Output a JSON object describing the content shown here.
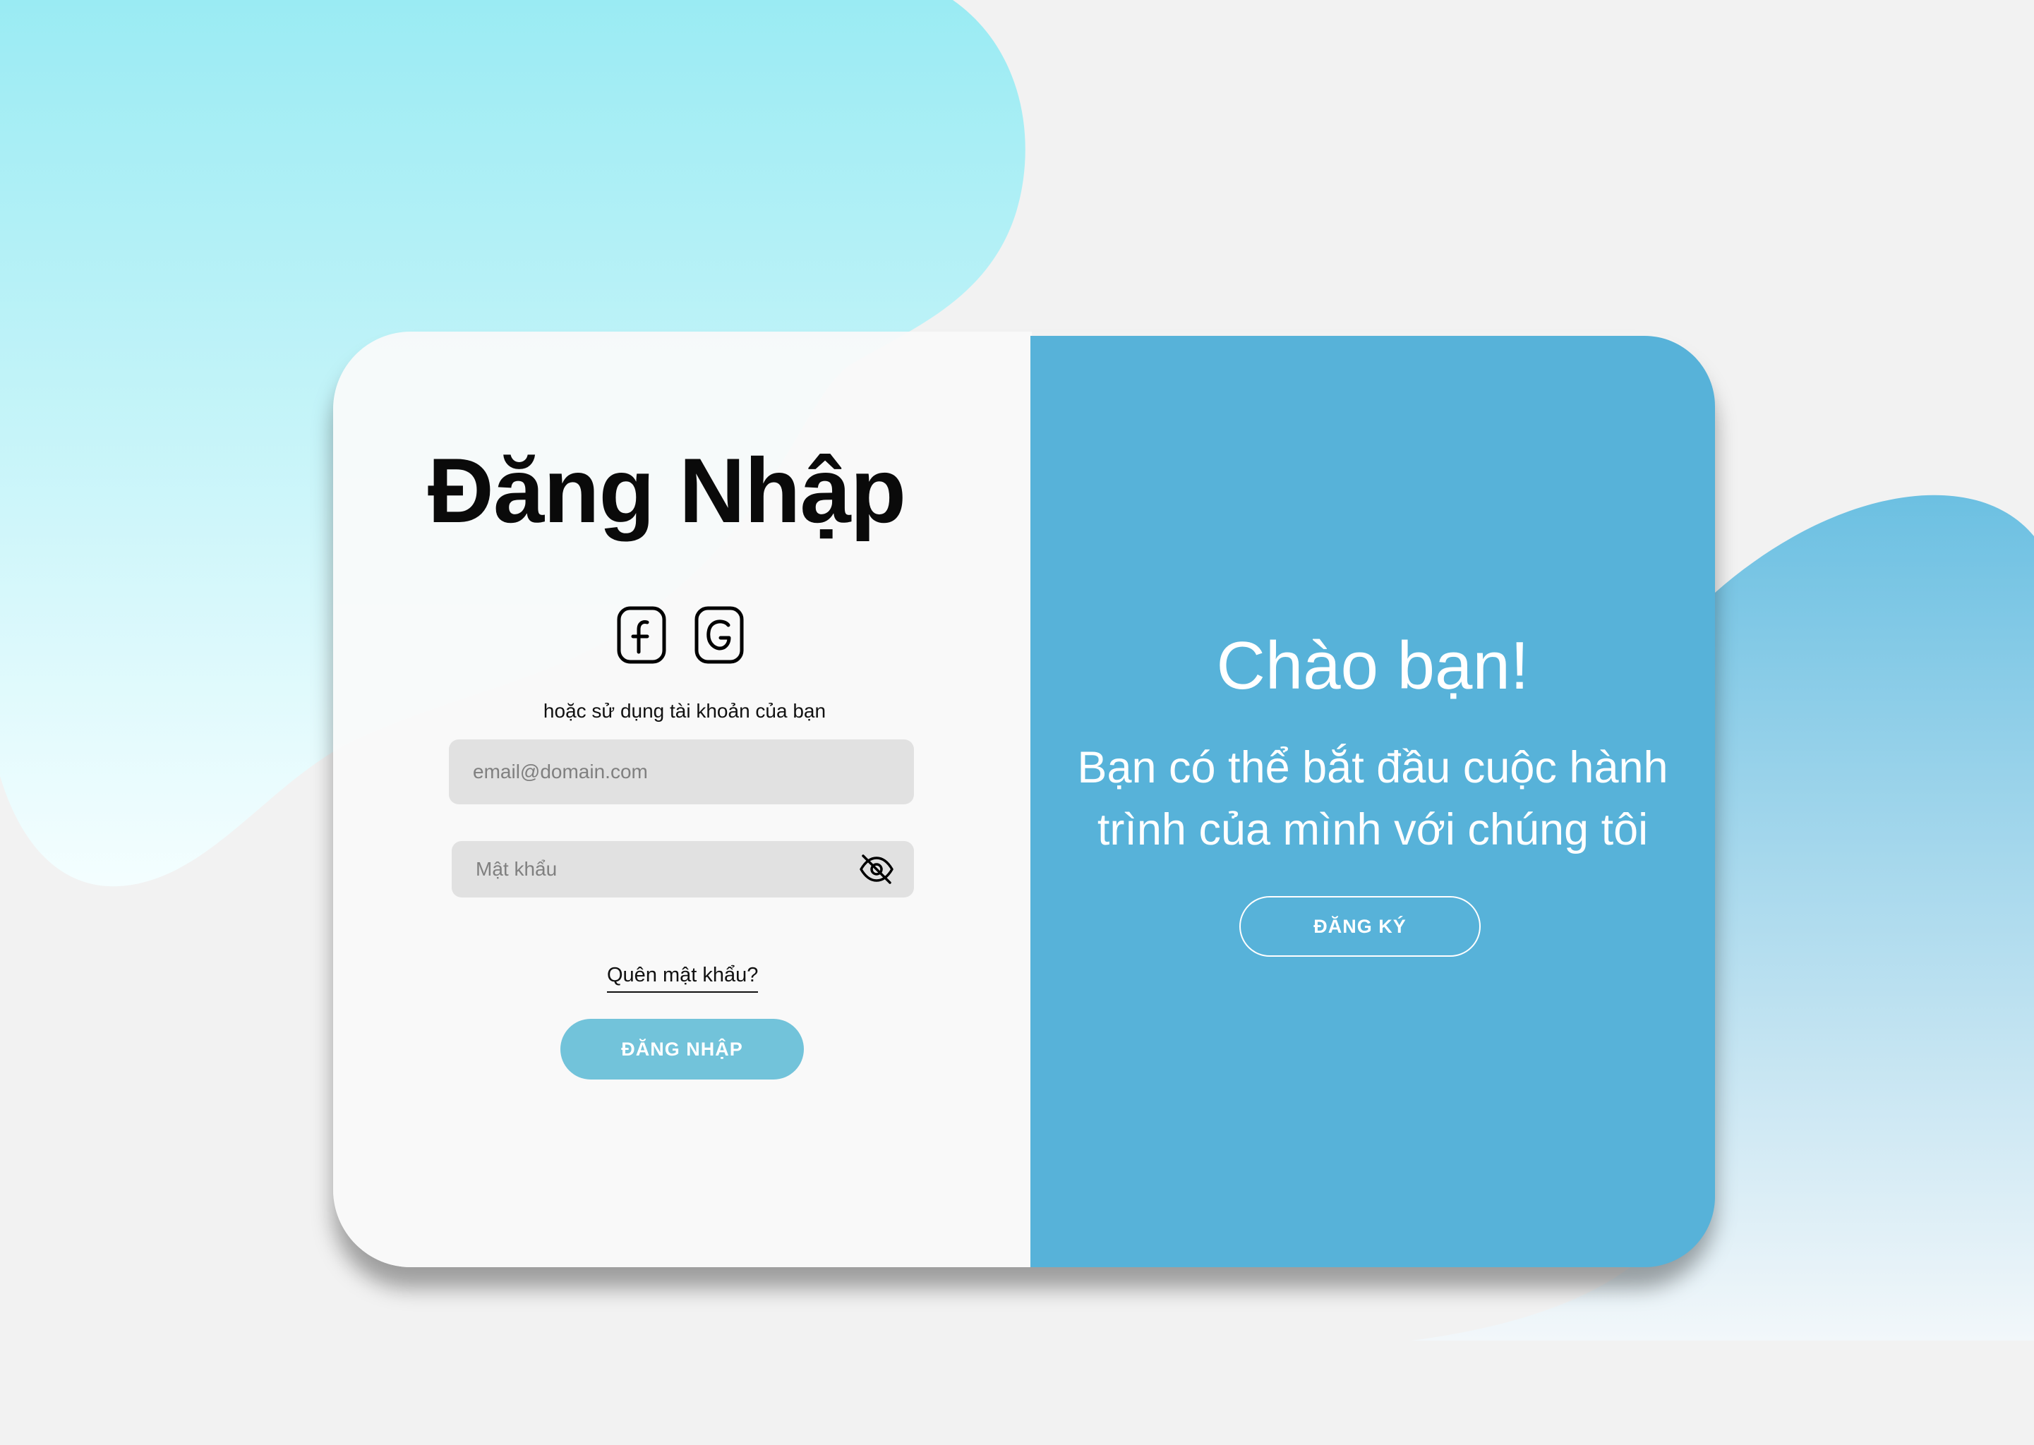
{
  "login": {
    "title": "Đăng Nhập",
    "social_icons": [
      "facebook-icon",
      "google-icon"
    ],
    "alt_text": "hoặc sử dụng tài khoản của bạn",
    "email_placeholder": "email@domain.com",
    "password_placeholder": "Mật khẩu",
    "forgot_password": "Quên mật khẩu?",
    "submit_label": "ĐĂNG NHẬP"
  },
  "welcome": {
    "title": "Chào bạn!",
    "line1": "Bạn có thể bắt đầu cuộc hành",
    "line2": "trình của mình với chúng tôi",
    "register_label": "ĐĂNG KÝ"
  },
  "colors": {
    "panel_blue": "#57b2d9",
    "login_button": "#72c3da",
    "input_bg": "#e1e1e1",
    "blob_cyan": "#9aebf3",
    "page_bg": "#f2f2f2"
  }
}
